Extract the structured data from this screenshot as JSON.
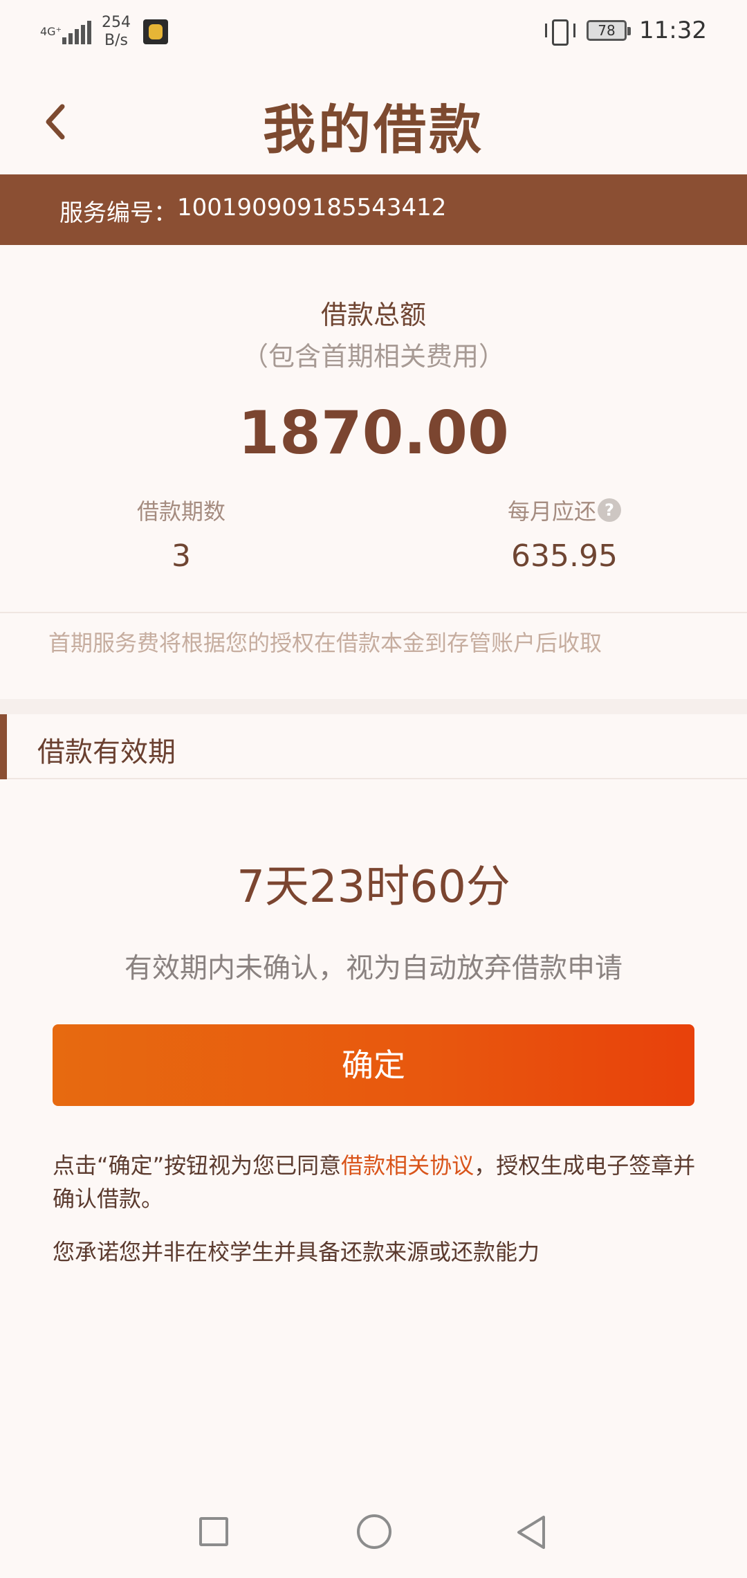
{
  "status_bar": {
    "network": "4G⁺",
    "speed_value": "254",
    "speed_unit": "B/s",
    "battery": "78",
    "time": "11:32"
  },
  "header": {
    "title": "我的借款",
    "back_icon": "chevron-left-icon"
  },
  "service": {
    "label": "服务编号：",
    "number": "100190909185543412"
  },
  "summary": {
    "total_label": "借款总额",
    "total_sub": "（包含首期相关费用）",
    "total_amount": "1870.00",
    "periods_label": "借款期数",
    "periods_value": "3",
    "monthly_label": "每月应还",
    "monthly_value": "635.95",
    "help_glyph": "?"
  },
  "fee_note": "首期服务费将根据您的授权在借款本金到存管账户后收取",
  "validity": {
    "section_title": "借款有效期",
    "countdown": "7天23时60分",
    "note": "有效期内未确认，视为自动放弃借款申请"
  },
  "confirm_button": "确定",
  "agreement": {
    "prefix": "点击“确定”按钮视为您已同意",
    "link": "借款相关协议",
    "suffix": "，授权生成电子签章并确认借款。"
  },
  "promise": "您承诺您并非在校学生并具备还款来源或还款能力",
  "colors": {
    "brand_brown": "#8b4f33",
    "button_orange": "#e8570e",
    "link_orange": "#d9541a"
  }
}
